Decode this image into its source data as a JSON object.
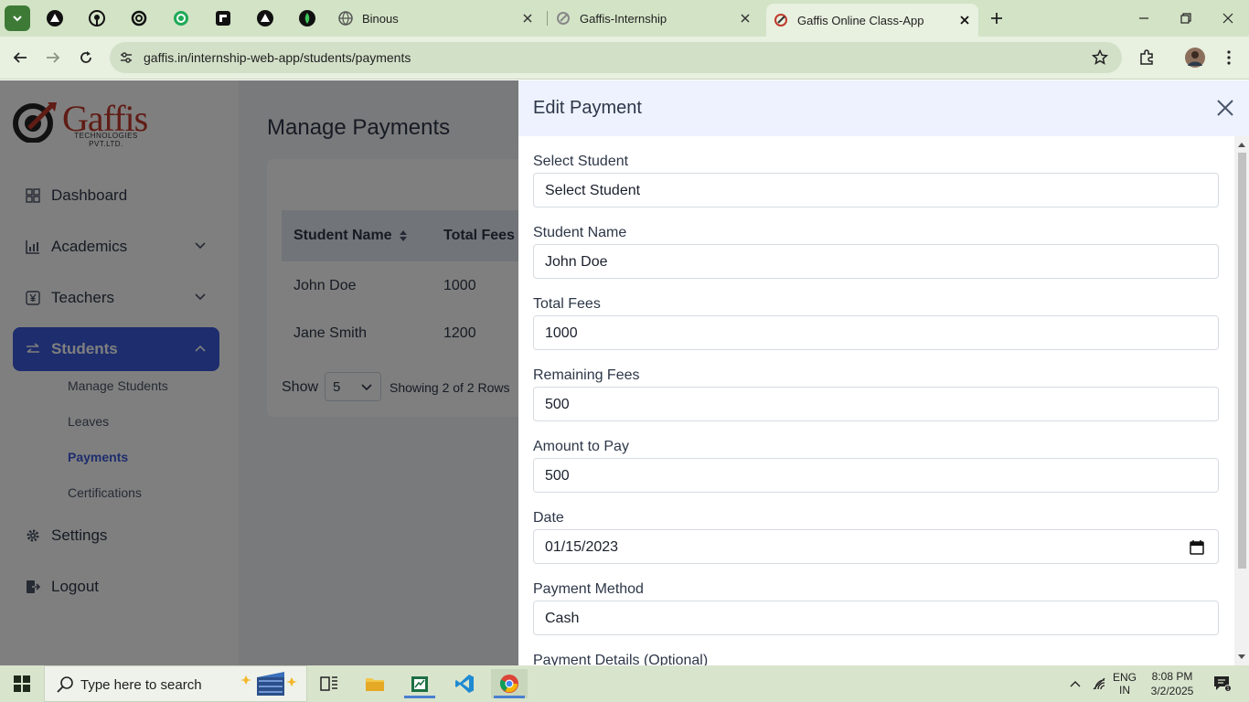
{
  "browser": {
    "tabs": [
      {
        "title": "Binous"
      },
      {
        "title": "Gaffis-Internship"
      },
      {
        "title": "Gaffis Online Class-App"
      }
    ],
    "url": "gaffis.in/internship-web-app/students/payments"
  },
  "app": {
    "logo": {
      "name": "Gaffis",
      "tagline": "TECHNOLOGIES PVT.LTD."
    },
    "nav": {
      "dashboard": "Dashboard",
      "academics": "Academics",
      "teachers": "Teachers",
      "students": "Students",
      "sub": {
        "manage_students": "Manage Students",
        "leaves": "Leaves",
        "payments": "Payments",
        "certifications": "Certifications"
      },
      "settings": "Settings",
      "logout": "Logout"
    },
    "page_title": "Manage Payments",
    "table": {
      "headers": {
        "student_name": "Student Name",
        "total_fees": "Total Fees"
      },
      "rows": [
        {
          "name": "John Doe",
          "fees": "1000"
        },
        {
          "name": "Jane Smith",
          "fees": "1200"
        }
      ]
    },
    "pager": {
      "show_label": "Show",
      "page_size": "5",
      "info": "Showing 2 of 2 Rows"
    },
    "drawer": {
      "title": "Edit Payment",
      "fields": {
        "select_student": {
          "label": "Select Student",
          "value": "Select Student"
        },
        "student_name": {
          "label": "Student Name",
          "value": "John Doe"
        },
        "total_fees": {
          "label": "Total Fees",
          "value": "1000"
        },
        "remaining_fees": {
          "label": "Remaining Fees",
          "value": "500"
        },
        "amount_to_pay": {
          "label": "Amount to Pay",
          "value": "500"
        },
        "date": {
          "label": "Date",
          "value": "01/15/2023"
        },
        "payment_method": {
          "label": "Payment Method",
          "value": "Cash"
        },
        "payment_details": {
          "label": "Payment Details (Optional)"
        }
      }
    }
  },
  "taskbar": {
    "search_placeholder": "Type here to search",
    "lang": "ENG",
    "region": "IN",
    "time": "8:08 PM",
    "date": "3/2/2025"
  },
  "colors": {
    "accent": "#3b5bdb",
    "chrome": "#d3e3c6",
    "drawer_head": "#eef2ff"
  }
}
